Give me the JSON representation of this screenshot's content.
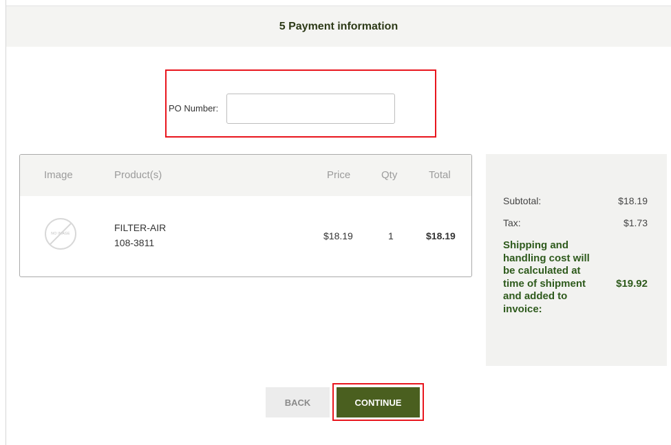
{
  "header": {
    "title": "5 Payment information"
  },
  "po": {
    "label": "PO Number:",
    "value": "",
    "placeholder": ""
  },
  "table": {
    "headers": {
      "image": "Image",
      "products": "Product(s)",
      "price": "Price",
      "qty": "Qty",
      "total": "Total"
    },
    "rows": [
      {
        "image_text": "NO IMAGE",
        "name": "FILTER-AIR",
        "part": "108-3811",
        "price": "$18.19",
        "qty": "1",
        "total": "$18.19"
      }
    ]
  },
  "summary": {
    "subtotal_label": "Subtotal:",
    "subtotal_value": "$18.19",
    "tax_label": "Tax:",
    "tax_value": "$1.73",
    "shipping_label": "Shipping and handling cost will be calculated at time of shipment and added to invoice:",
    "shipping_value": "$19.92"
  },
  "buttons": {
    "back": "BACK",
    "continue": "CONTINUE"
  },
  "colors": {
    "accent_green": "#4a5f1f",
    "highlight_red": "#e8141c",
    "summary_green": "#2e5a1c"
  }
}
